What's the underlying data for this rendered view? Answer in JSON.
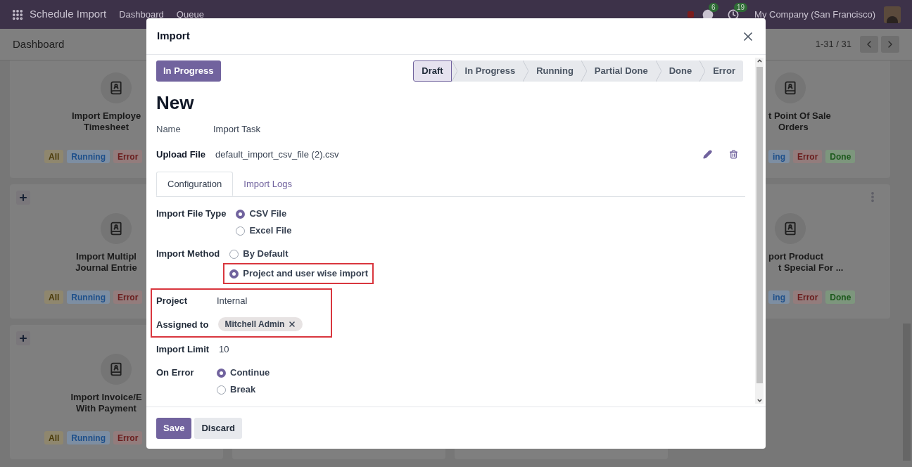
{
  "navbar": {
    "app_title": "Schedule Import",
    "menu": [
      "Dashboard",
      "Queue"
    ],
    "messages_count": "6",
    "activities_count": "19",
    "company": "My Company (San Francisco)"
  },
  "control_panel": {
    "breadcrumb": "Dashboard",
    "pager": "1-31 / 31"
  },
  "left_cards": [
    {
      "title_lines": [
        "Import Employe",
        "Timesheet"
      ],
      "badges": [
        {
          "label": "All",
          "kind": "all"
        },
        {
          "label": "Running",
          "kind": "running"
        },
        {
          "label": "Error",
          "kind": "error"
        }
      ]
    },
    {
      "title_lines": [
        "Import Multipl",
        "Journal Entrie"
      ],
      "add_button": true,
      "badges": [
        {
          "label": "All",
          "kind": "all"
        },
        {
          "label": "Running",
          "kind": "running"
        },
        {
          "label": "Error",
          "kind": "error"
        }
      ]
    },
    {
      "title_lines": [
        "Import Invoice/E",
        "With Payment"
      ],
      "add_button": true,
      "badges": [
        {
          "label": "All",
          "kind": "all"
        },
        {
          "label": "Running",
          "kind": "running"
        },
        {
          "label": "Error",
          "kind": "error"
        }
      ]
    }
  ],
  "right_cards": [
    {
      "title_lines": [
        "t Point Of Sale",
        "Orders"
      ],
      "menu_button": false,
      "badges": [
        {
          "label": "ing",
          "kind": "running"
        },
        {
          "label": "Error",
          "kind": "error"
        },
        {
          "label": "Done",
          "kind": "done"
        }
      ]
    },
    {
      "title_lines": [
        "port Product",
        "t Special For ..."
      ],
      "menu_button": true,
      "badges": [
        {
          "label": "ing",
          "kind": "running"
        },
        {
          "label": "Error",
          "kind": "error"
        },
        {
          "label": "Done",
          "kind": "done"
        }
      ]
    }
  ],
  "dialog": {
    "title": "Import",
    "status_button": "In Progress",
    "stages": [
      {
        "label": "Draft",
        "selected": true
      },
      {
        "label": "In Progress",
        "selected": false
      },
      {
        "label": "Running",
        "selected": false
      },
      {
        "label": "Partial Done",
        "selected": false
      },
      {
        "label": "Done",
        "selected": false
      },
      {
        "label": "Error",
        "selected": false
      }
    ],
    "record_title": "New",
    "name_label": "Name",
    "name_value": "Import Task",
    "upload_label": "Upload File",
    "upload_value": "default_import_csv_file (2).csv",
    "tabs": [
      {
        "label": "Configuration",
        "selected": true
      },
      {
        "label": "Import Logs",
        "selected": false
      }
    ],
    "fields": [
      {
        "kind": "radio",
        "label": "Import File Type",
        "highlighted": false,
        "options": [
          {
            "label": "CSV File",
            "selected": true,
            "highlighted": false
          },
          {
            "label": "Excel File",
            "selected": false,
            "highlighted": false
          }
        ]
      },
      {
        "kind": "radio",
        "label": "Import Method",
        "highlighted": false,
        "options": [
          {
            "label": "By Default",
            "selected": false,
            "highlighted": false
          },
          {
            "label": "Project and user wise import",
            "selected": true,
            "highlighted": true
          }
        ]
      },
      {
        "kind": "text",
        "label": "Project",
        "highlighted": true,
        "value": "Internal"
      },
      {
        "kind": "tags",
        "label": "Assigned to",
        "highlighted": true,
        "tags": [
          "Mitchell Admin"
        ]
      },
      {
        "kind": "text",
        "label": "Import Limit",
        "highlighted": false,
        "value": "10"
      },
      {
        "kind": "radio",
        "label": "On Error",
        "highlighted": false,
        "options": [
          {
            "label": "Continue",
            "selected": true,
            "highlighted": false
          },
          {
            "label": "Break",
            "selected": false,
            "highlighted": false
          }
        ]
      }
    ],
    "buttons": [
      {
        "label": "Save",
        "kind": "primary"
      },
      {
        "label": "Discard",
        "kind": "secondary"
      }
    ]
  }
}
